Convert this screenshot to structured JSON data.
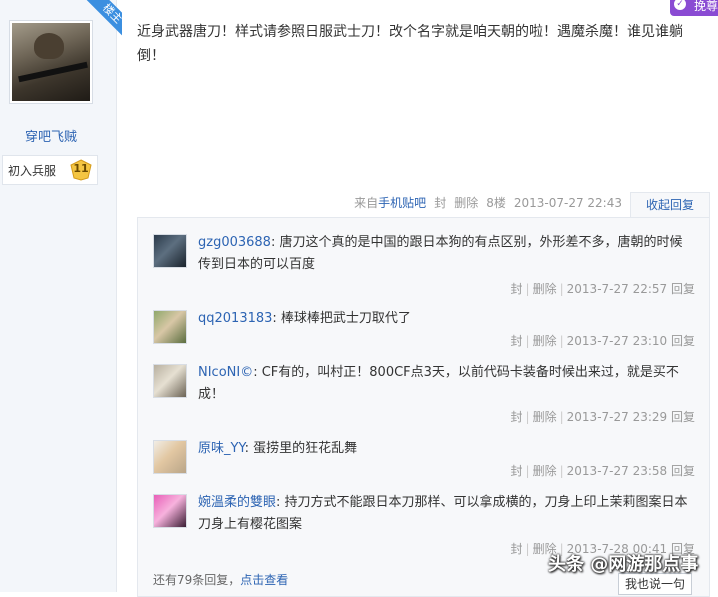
{
  "sidebar": {
    "badge": "楼主",
    "username": "穿吧飞贼",
    "rank_label": "初入兵服",
    "rank_level": "11"
  },
  "top_tag": {
    "label": "挽尊"
  },
  "post": {
    "content": "近身武器唐刀！样式请参照日服武士刀！改个名字就是咱天朝的啦！遇魔杀魔！谁见谁躺倒！",
    "from_prefix": "来自",
    "from_link": "手机贴吧",
    "seal": "封",
    "delete": "删除",
    "floor": "8楼",
    "time": "2013-07-27 22:43",
    "collapse_label": "收起回复"
  },
  "replies": [
    {
      "user": "gzg003688",
      "text": ": 唐刀这个真的是中国的跟日本狗的有点区别，外形差不多，唐朝的时候传到日本的可以百度",
      "seal": "封",
      "delete": "删除",
      "time": "2013-7-27 22:57",
      "reply": "回复"
    },
    {
      "user": "qq2013183",
      "text": ": 棒球棒把武士刀取代了",
      "seal": "封",
      "delete": "删除",
      "time": "2013-7-27 23:10",
      "reply": "回复"
    },
    {
      "user": "NIcoNI©",
      "text": ": CF有的，叫村正！800CF点3天，以前代码卡装备时候出来过，就是买不成！",
      "seal": "封",
      "delete": "删除",
      "time": "2013-7-27 23:29",
      "reply": "回复"
    },
    {
      "user": "原味_YY",
      "text": ": 蛋捞里的狂花乱舞",
      "seal": "封",
      "delete": "删除",
      "time": "2013-7-27 23:58",
      "reply": "回复"
    },
    {
      "user": "婉溫柔的雙眼",
      "text": ": 持刀方式不能跟日本刀那样、可以拿成横的，刀身上印上茉莉图案日本刀身上有樱花图案",
      "seal": "封",
      "delete": "删除",
      "time": "2013-7-28 00:41",
      "reply": "回复"
    }
  ],
  "more": {
    "text": "还有79条回复，",
    "link": "点击查看",
    "say_button": "我也说一句"
  },
  "watermark": "头条 @网游那点事",
  "colors": {
    "link": "#2d64b3",
    "meta": "#999999",
    "top_tag": "#8a4bd3",
    "badge": "#3b8fe0"
  }
}
